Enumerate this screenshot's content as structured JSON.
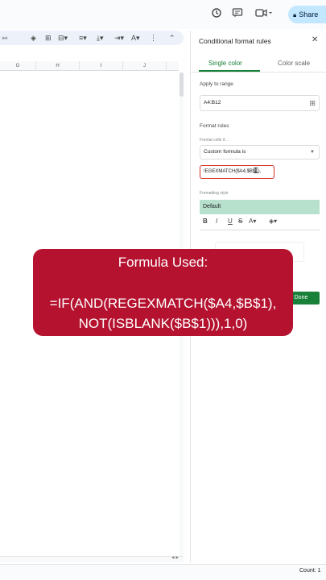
{
  "topbar": {
    "history_icon": "history-icon",
    "comment_icon": "comment-icon",
    "meet_icon": "video-camera-icon",
    "share_label": "Share"
  },
  "toolbar": {
    "icons": [
      "text-color-icon",
      "fill-color-icon",
      "borders-icon",
      "merge-cells-icon",
      "align-left-icon",
      "valign-icon",
      "text-wrap-icon",
      "text-rotation-icon",
      "collapse-toolbar-icon"
    ]
  },
  "sheet": {
    "columns": [
      "G",
      "H",
      "I",
      "J"
    ]
  },
  "panel": {
    "title": "Conditional format rules",
    "tabs": [
      "Single color",
      "Color scale"
    ],
    "apply_to_range_label": "Apply to range",
    "range_value": "A4:B12",
    "format_rules_label": "Format rules",
    "format_cells_if_label": "Format cells if…",
    "condition_value": "Custom formula is",
    "formula_value": "!EGEXMATCH($A4,$B$1),",
    "formatting_style_label": "Formatting style",
    "style_preview": "Default",
    "style_tools": [
      "B",
      "I",
      "U",
      "S",
      "A",
      "fill"
    ],
    "done_label": "Done"
  },
  "overlay": {
    "title": "Formula Used:",
    "line1": "=IF(AND(REGEXMATCH($A4,$B$1),",
    "line2": "NOT(ISBLANK($B$1))),1,0)"
  },
  "statusbar": {
    "count": "Count: 1"
  },
  "colors": {
    "accent_green": "#188038",
    "banner_red": "#b5122f",
    "share_blue": "#c2e7ff",
    "error_red": "#d93025",
    "style_green": "#b7e1cd"
  }
}
